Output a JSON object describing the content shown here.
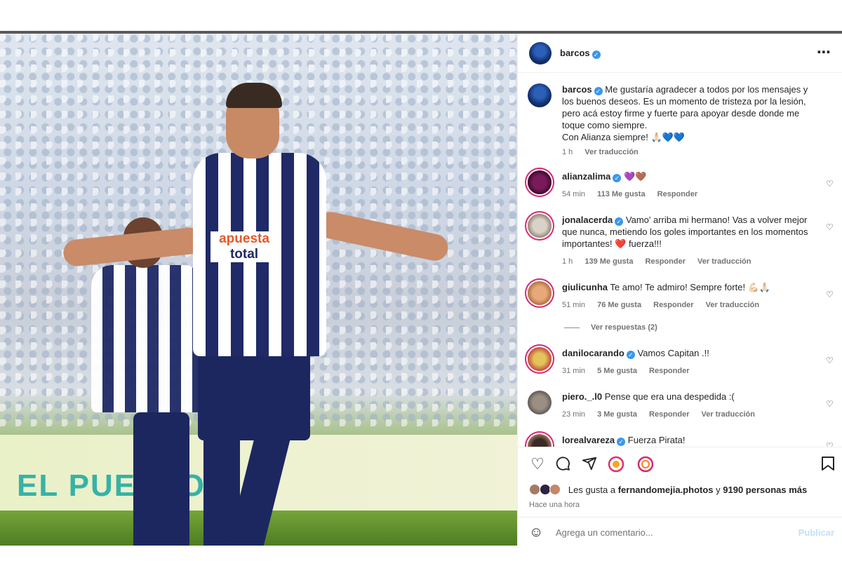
{
  "post": {
    "author": "barcos",
    "photo": {
      "sponsor_top": "apuesta",
      "sponsor_bottom": "total",
      "banner_text": "EL PUEBLO"
    }
  },
  "header": {
    "username": "barcos",
    "more_icon": "⋯"
  },
  "caption": {
    "username": "barcos",
    "text": "Me gustaría agradecer a todos por los mensajes y los buenos deseos. Es un momento de tristeza por la lesión, pero acá estoy firme y fuerte para apoyar desde donde me toque como siempre.",
    "line2": "Con Alianza siempre! 🙏🏻💙💙",
    "time": "1 h",
    "translate": "Ver traducción"
  },
  "comments": [
    {
      "username": "alianzalima",
      "text": "💜🤎",
      "time": "54 min",
      "likes": "113 Me gusta",
      "reply": "Responder",
      "translate": ""
    },
    {
      "username": "jonalacerda",
      "text": "Vamo' arriba mi hermano! Vas a volver mejor que nunca, metiendo los goles importantes en los momentos importantes! ❤️ fuerza!!!",
      "time": "1 h",
      "likes": "139 Me gusta",
      "reply": "Responder",
      "translate": "Ver traducción"
    },
    {
      "username": "giulicunha",
      "text": "Te amo! Te admiro! Sempre forte! 💪🏻🙏🏻",
      "time": "51 min",
      "likes": "76 Me gusta",
      "reply": "Responder",
      "translate": "Ver traducción"
    },
    {
      "username": "danilocarando",
      "text": "Vamos Capitan .!!",
      "time": "31 min",
      "likes": "5 Me gusta",
      "reply": "Responder",
      "translate": ""
    },
    {
      "username": "piero._.l0",
      "text": "Pense que era una despedida :(",
      "time": "23 min",
      "likes": "3 Me gusta",
      "reply": "Responder",
      "translate": "Ver traducción"
    },
    {
      "username": "lorealvareza",
      "text": "Fuerza Pirata!",
      "time": "",
      "likes": "",
      "reply": "",
      "translate": ""
    }
  ],
  "view_replies": "Ver respuestas (2)",
  "likes_summary": {
    "prefix": "Les gusta a",
    "user": "fernandomejia.photos",
    "middle": "y",
    "count": "9190 personas más"
  },
  "timestamp": "Hace una hora",
  "add_comment": {
    "placeholder": "Agrega un comentario...",
    "post_label": "Publicar"
  },
  "colors": {
    "accent_blue": "#3897f0",
    "text": "#262626",
    "muted": "#737373",
    "border": "#efefef",
    "club_navy": "#1f2a66"
  },
  "icons": [
    "heart-icon",
    "comment-icon",
    "share-icon",
    "reel-icon",
    "remix-icon",
    "bookmark-icon",
    "smile-icon",
    "verified-icon",
    "more-icon"
  ]
}
